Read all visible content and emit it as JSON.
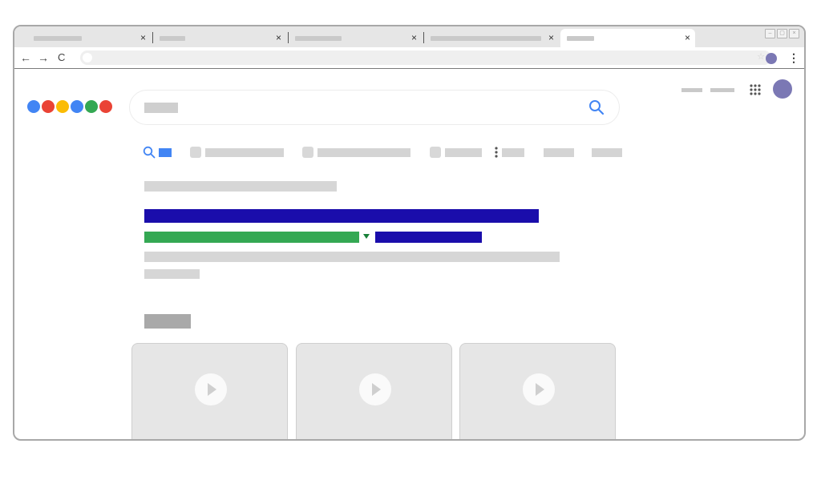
{
  "browser": {
    "tabs": [
      {
        "close_glyph": "×"
      },
      {
        "close_glyph": "×"
      },
      {
        "close_glyph": "×"
      },
      {
        "close_glyph": "×"
      },
      {
        "close_glyph": "×",
        "active": true
      }
    ],
    "window_controls": [
      "–",
      "▢",
      "×"
    ],
    "nav": {
      "back": "←",
      "forward": "→",
      "reload": "C"
    },
    "star_glyph": "☆",
    "menu_glyph": "⋮",
    "profile_color": "#7b78b4"
  },
  "page": {
    "logo_colors": [
      "#4285f4",
      "#ea4335",
      "#fbbc05",
      "#4285f4",
      "#34a853",
      "#ea4335"
    ],
    "search_icon": "search-icon",
    "accent": "#4285f4",
    "result": {
      "title_color": "#1a0dab",
      "url_color": "#34a853"
    },
    "video_cards": [
      {
        "icon": "play-icon"
      },
      {
        "icon": "play-icon"
      },
      {
        "icon": "play-icon"
      }
    ]
  }
}
